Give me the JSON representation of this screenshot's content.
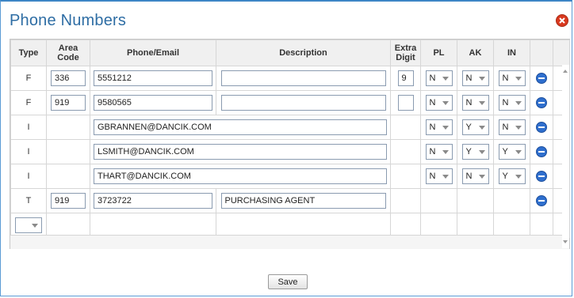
{
  "dialog": {
    "title": "Phone Numbers",
    "close_icon": "close-icon",
    "save_label": "Save"
  },
  "columns": [
    "Type",
    "Area Code",
    "Phone/Email",
    "Description",
    "Extra Digit",
    "PL",
    "AK",
    "IN"
  ],
  "rows": [
    {
      "type": "F",
      "area": "336",
      "phone": "5551212",
      "description": "",
      "extra": "9",
      "pl": "N",
      "ak": "N",
      "in": "N"
    },
    {
      "type": "F",
      "area": "919",
      "phone": "9580565",
      "description": "",
      "extra": "",
      "pl": "N",
      "ak": "N",
      "in": "N"
    },
    {
      "type": "I",
      "email": "GBRANNEN@DANCIK.COM",
      "pl": "N",
      "ak": "Y",
      "in": "N"
    },
    {
      "type": "I",
      "email": "LSMITH@DANCIK.COM",
      "pl": "N",
      "ak": "Y",
      "in": "Y"
    },
    {
      "type": "I",
      "email": "THART@DANCIK.COM",
      "pl": "N",
      "ak": "N",
      "in": "Y"
    },
    {
      "type": "T",
      "area": "919",
      "phone": "3723722",
      "description": "PURCHASING AGENT"
    }
  ],
  "new_row": {
    "type": ""
  },
  "colors": {
    "title": "#2e6da4",
    "close": "#d9391f",
    "delete": "#2f6fce",
    "border": "#5b9bd5"
  }
}
